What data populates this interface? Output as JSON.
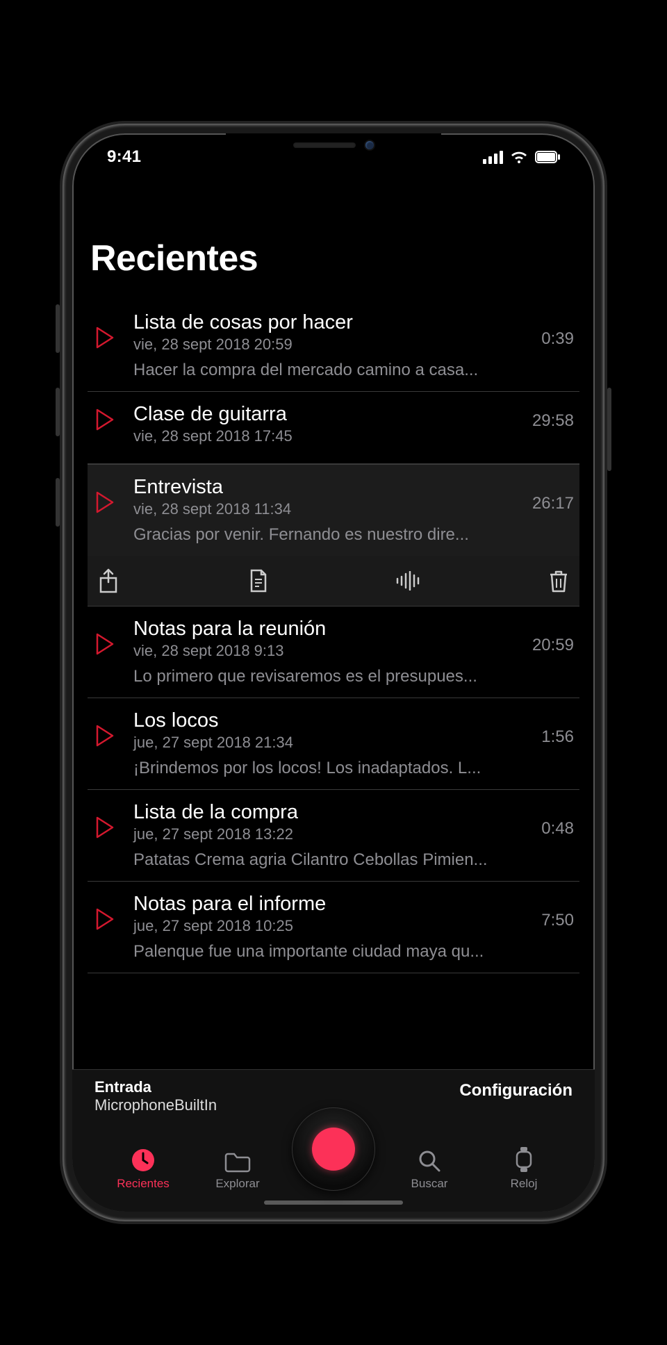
{
  "status": {
    "time": "9:41"
  },
  "header": {
    "title": "Recientes"
  },
  "accent": "#fc3158",
  "recordings": [
    {
      "title": "Lista de cosas por hacer",
      "date": "vie, 28 sept 2018 20:59",
      "duration": "0:39",
      "preview": "Hacer la compra del mercado camino a casa...",
      "selected": false
    },
    {
      "title": "Clase de guitarra",
      "date": "vie, 28 sept 2018 17:45",
      "duration": "29:58",
      "preview": "",
      "selected": false
    },
    {
      "title": "Entrevista",
      "date": "vie, 28 sept 2018 11:34",
      "duration": "26:17",
      "preview": "Gracias por venir.  Fernando es nuestro dire...",
      "selected": true
    },
    {
      "title": "Notas para la reunión",
      "date": "vie, 28 sept 2018 9:13",
      "duration": "20:59",
      "preview": "Lo primero que revisaremos es el presupues...",
      "selected": false
    },
    {
      "title": "Los locos",
      "date": "jue, 27 sept 2018 21:34",
      "duration": "1:56",
      "preview": "¡Brindemos por los locos! Los inadaptados. L...",
      "selected": false
    },
    {
      "title": "Lista de la compra",
      "date": "jue, 27 sept 2018 13:22",
      "duration": "0:48",
      "preview": "Patatas Crema agria Cilantro Cebollas Pimien...",
      "selected": false
    },
    {
      "title": "Notas para el informe",
      "date": "jue, 27 sept 2018 10:25",
      "duration": "7:50",
      "preview": "Palenque fue una importante ciudad maya qu...",
      "selected": false
    }
  ],
  "input": {
    "label": "Entrada",
    "value": "MicrophoneBuiltIn"
  },
  "settings_label": "Configuración",
  "tabs": {
    "recents": "Recientes",
    "browse": "Explorar",
    "search": "Buscar",
    "watch": "Reloj"
  },
  "toolbar_icons": {
    "share": "share-icon",
    "transcript": "document-icon",
    "waveform": "waveform-icon",
    "delete": "trash-icon"
  }
}
